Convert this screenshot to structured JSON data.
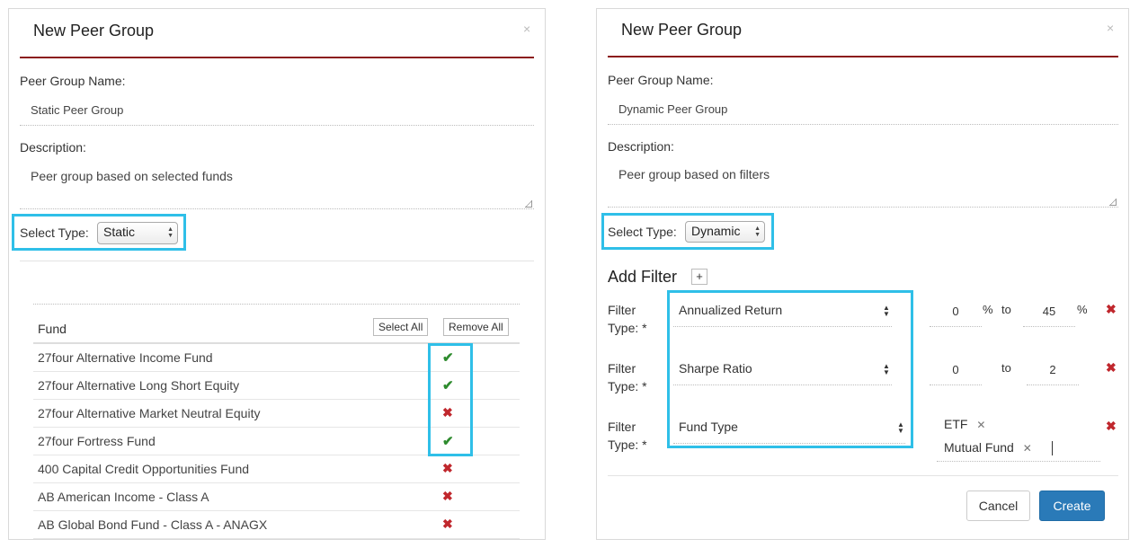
{
  "left": {
    "title": "New Peer Group",
    "close": "×",
    "name_label": "Peer Group Name:",
    "name_value": "Static Peer Group",
    "description_label": "Description:",
    "description_value": "Peer group based on selected funds",
    "select_type_label": "Select Type:",
    "select_type_value": "Static",
    "fund_header": "Fund",
    "select_all": "Select All",
    "remove_all": "Remove All",
    "funds": [
      {
        "name": "27four Alternative Income Fund",
        "status": "✔"
      },
      {
        "name": "27four Alternative Long Short Equity",
        "status": "✔"
      },
      {
        "name": "27four Alternative Market Neutral Equity",
        "status": "✖"
      },
      {
        "name": "27four Fortress Fund",
        "status": "✔"
      },
      {
        "name": "400 Capital Credit Opportunities Fund",
        "status": "✖"
      },
      {
        "name": "AB American Income - Class A",
        "status": "✖"
      },
      {
        "name": "AB Global Bond Fund - Class A - ANAGX",
        "status": "✖"
      }
    ]
  },
  "right": {
    "title": "New Peer Group",
    "close": "×",
    "name_label": "Peer Group Name:",
    "name_value": "Dynamic Peer Group",
    "description_label": "Description:",
    "description_value": "Peer group based on filters",
    "select_type_label": "Select Type:",
    "select_type_value": "Dynamic",
    "add_filter": "Add Filter",
    "add_filter_plus": "+",
    "filter_label_1": "Filter",
    "filter_label_2": "Type: *",
    "filters": [
      {
        "type": "Annualized Return",
        "from": "0",
        "from_unit": "%",
        "to_word": "to",
        "to": "45",
        "to_unit": "%"
      },
      {
        "type": "Sharpe Ratio",
        "from": "0",
        "from_unit": "",
        "to_word": "to",
        "to": "2",
        "to_unit": ""
      },
      {
        "type": "Fund Type",
        "tags": [
          "ETF",
          "Mutual Fund"
        ]
      }
    ],
    "remove_icon": "✖",
    "tag_remove": "✕",
    "cancel": "Cancel",
    "create": "Create"
  }
}
